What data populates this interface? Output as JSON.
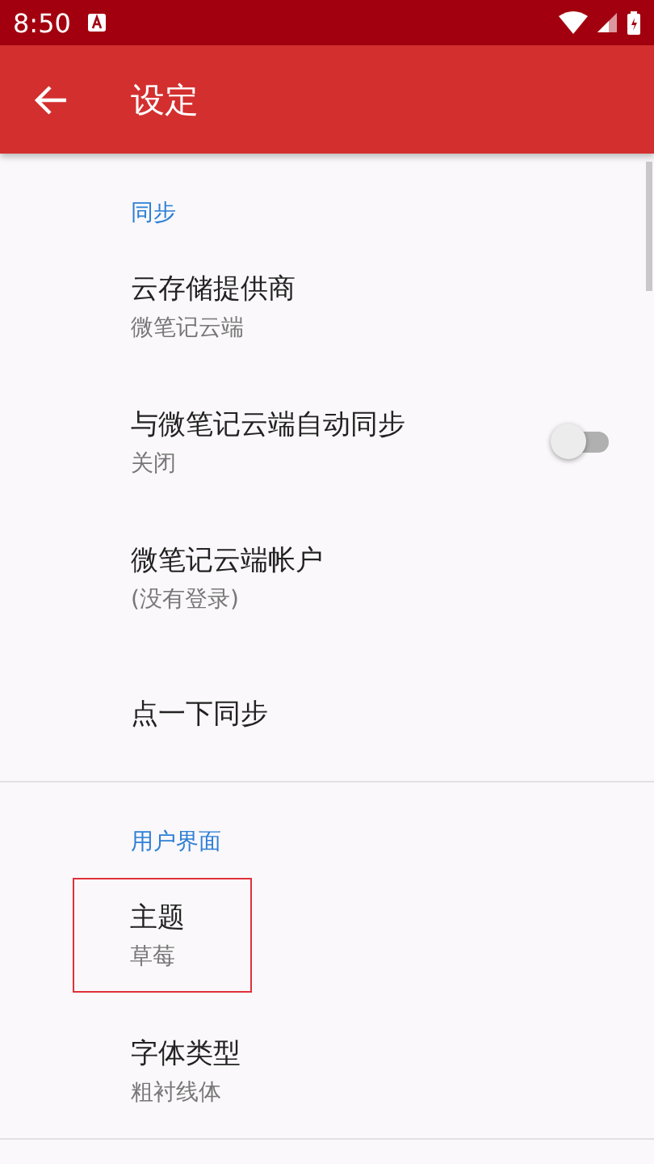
{
  "status_bar": {
    "time": "8:50"
  },
  "app_bar": {
    "title": "设定"
  },
  "sections": [
    {
      "header": "同步",
      "items": [
        {
          "kind": "text",
          "title": "云存储提供商",
          "summary": "微笔记云端",
          "highlighted": false
        },
        {
          "kind": "switch",
          "title": "与微笔记云端自动同步",
          "summary": "关闭",
          "on": false,
          "highlighted": false
        },
        {
          "kind": "text",
          "title": "微笔记云端帐户",
          "summary": "(没有登录)",
          "highlighted": false
        },
        {
          "kind": "text",
          "title": "点一下同步",
          "highlighted": false
        }
      ]
    },
    {
      "header": "用户界面",
      "items": [
        {
          "kind": "text",
          "title": "主题",
          "summary": "草莓",
          "highlighted": true
        },
        {
          "kind": "text",
          "title": "字体类型",
          "summary": "粗衬线体",
          "highlighted": false
        }
      ]
    }
  ]
}
